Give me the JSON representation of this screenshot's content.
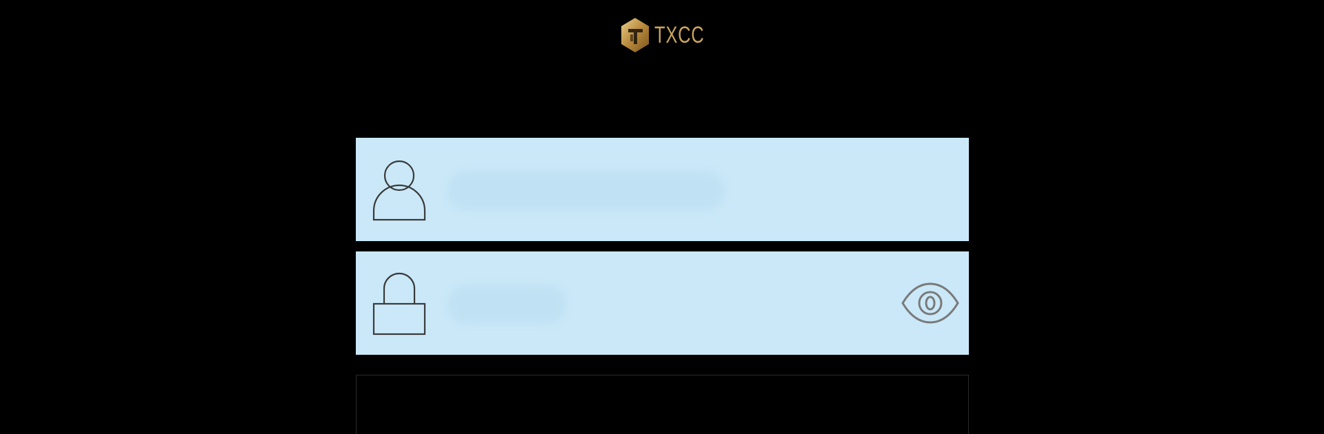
{
  "brand": {
    "name": "TXCC",
    "logo_icon": "hexagon-t-logo-icon",
    "color": "#c8a45c"
  },
  "login_form": {
    "username": {
      "icon": "user-icon",
      "value": "",
      "placeholder": ""
    },
    "password": {
      "icon": "lock-icon",
      "value": "",
      "placeholder": "",
      "toggle_icon": "eye-icon"
    },
    "submit_label": ""
  },
  "colors": {
    "background": "#000000",
    "field_background": "#cae8f8",
    "icon_stroke": "#3a3a3a"
  }
}
